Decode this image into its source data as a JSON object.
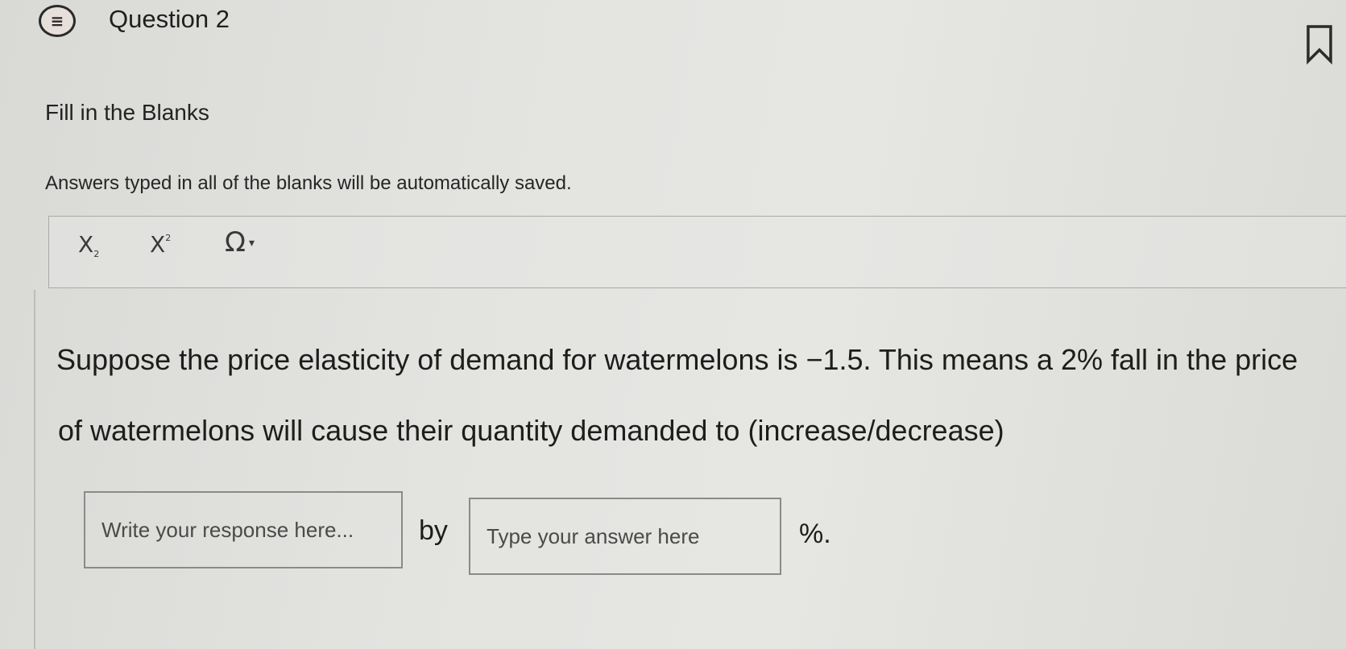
{
  "header": {
    "question_icon": "list-icon",
    "title": "Question 2",
    "bookmark_icon": "bookmark-icon"
  },
  "section": {
    "title": "Fill in the Blanks",
    "autosave_note": "Answers typed in all of the blanks will be automatically saved."
  },
  "toolbar": {
    "subscript_label": "X",
    "subscript_mark": "2",
    "superscript_label": "X",
    "superscript_mark": "2",
    "symbols_label": "Ω"
  },
  "question": {
    "line1": "Suppose the price elasticity of demand for watermelons is −1.5. This means a 2% fall in the price",
    "line2": "of watermelons will cause their quantity demanded to (increase/decrease)"
  },
  "answers": {
    "blank1_placeholder": "Write your response here...",
    "connector": "by",
    "blank2_placeholder": "Type your answer here",
    "suffix": "%."
  }
}
